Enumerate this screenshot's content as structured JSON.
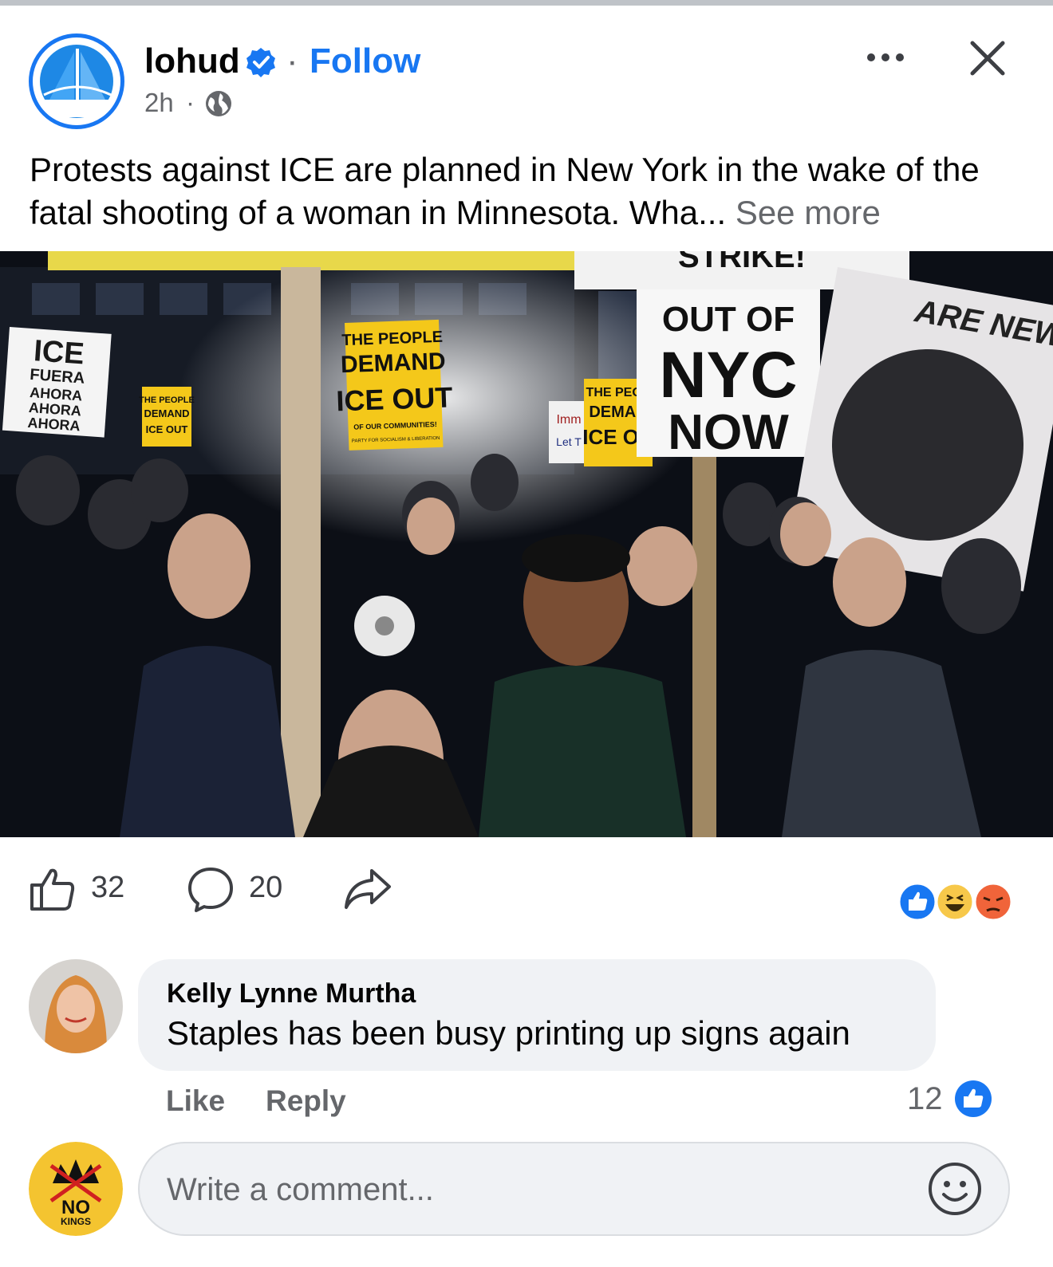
{
  "post": {
    "page_name": "lohud",
    "dot": "·",
    "follow_label": "Follow",
    "time": "2h",
    "time_sep": "·",
    "text": "Protests against ICE are planned in New York in the wake of the fatal shooting of a woman in Minnesota. Wha...",
    "see_more": "See more",
    "photo": {
      "signs": {
        "ice_fuera": [
          "ICE",
          "FUERA",
          "AHORA",
          "AHORA",
          "AHORA"
        ],
        "people_demand": [
          "THE PEOPLE",
          "DEMAND",
          "ICE OUT",
          "OF OUR COMMUNITIES!",
          "PARTY FOR SOCIALISM & LIBERATION"
        ],
        "people_demand_small": [
          "THE PEOPLE",
          "DEMAND",
          "ICE OUT"
        ],
        "nyc": [
          "OUT OF",
          "NYC",
          "NOW"
        ],
        "top_banner": "STRIKE!",
        "right_banner": "ARE NEW",
        "side_sign": [
          "Imm",
          "Let T"
        ],
        "mid_sign": [
          "THE PEOP",
          "DEMAN",
          "ICE OU"
        ]
      }
    }
  },
  "actions": {
    "like_count": "32",
    "comment_count": "20",
    "icons": [
      "like-outline-icon",
      "comment-outline-icon",
      "share-outline-icon"
    ],
    "reactions": [
      "like-reaction-icon",
      "haha-reaction-icon",
      "angry-reaction-icon"
    ]
  },
  "comment": {
    "author": "Kelly Lynne Murtha",
    "text": "Staples has been busy printing up signs again",
    "like_label": "Like",
    "reply_label": "Reply",
    "reaction_count": "12"
  },
  "compose": {
    "placeholder": "Write a comment...",
    "avatar_badge": [
      "NO",
      "KINGS"
    ]
  },
  "colors": {
    "accent": "#1877f2",
    "muted": "#65676b",
    "bubble": "#f0f2f5",
    "sign_yellow": "#f4c81a"
  }
}
